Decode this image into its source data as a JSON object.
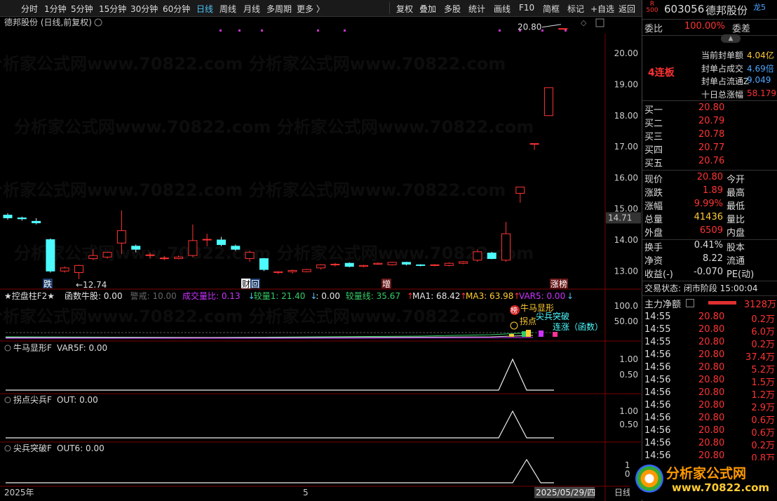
{
  "toolbar": {
    "left": [
      "分时",
      "1分钟",
      "5分钟",
      "15分钟",
      "30分钟",
      "60分钟",
      "日线",
      "周线",
      "月线",
      "多周期",
      "更多 〉"
    ],
    "active": "日线",
    "right": [
      "复权",
      "叠加",
      "多股",
      "统计",
      "画线",
      "F10",
      "简框",
      "标记",
      "+自选",
      "返回"
    ]
  },
  "stock": {
    "code": "603056",
    "name": "德邦股份",
    "market_badge": "R",
    "market_sub": "500",
    "tag": "龙5",
    "chart_title": "德邦股份 (日线,前复权)"
  },
  "main_chart": {
    "yticks": [
      "20.00",
      "19.00",
      "18.00",
      "17.00",
      "16.00",
      "15.00",
      "14.00",
      "13.00"
    ],
    "current_price_label": "14.71",
    "high_label": "20.80",
    "low_label": "←12.74",
    "markers": [
      "跌",
      "财",
      "回",
      "增",
      "涨",
      "榜"
    ]
  },
  "indicator1": {
    "title": "★控盘柱F2★",
    "items": [
      {
        "t": "函数牛股: 0.00",
        "c": "#e6e6e6"
      },
      {
        "t": "警戒: 10.00",
        "c": "#666666"
      },
      {
        "t": "成交量比: 0.13",
        "c": "#cc33ff"
      },
      {
        "t": "↓",
        "c": "#4fc3f7"
      },
      {
        "t": "较量1: 21.40",
        "c": "#33cc66"
      },
      {
        "t": "↓",
        "c": "#4fc3f7"
      },
      {
        "t": ": 0.00",
        "c": "#e6e6e6"
      },
      {
        "t": "较量线: 35.67",
        "c": "#33cc66"
      },
      {
        "t": "↑",
        "c": "#ff3333"
      },
      {
        "t": "MA1: 68.42",
        "c": "#e6e6e6"
      },
      {
        "t": "↑",
        "c": "#ff3333"
      },
      {
        "t": "MA3: 63.98",
        "c": "#ffcc33"
      },
      {
        "t": "↑",
        "c": "#ff3333"
      },
      {
        "t": "VAR5: 0.00",
        "c": "#cc33ff"
      },
      {
        "t": "↓",
        "c": "#4fc3f7"
      }
    ],
    "yticks": [
      "100.0",
      "50.00"
    ],
    "labels": [
      "牛马显形",
      "尖兵突破",
      "拐点",
      "连涨（函数）",
      "榜"
    ]
  },
  "indicator2": {
    "title": "牛马显形F",
    "var": "VAR5F: 0.00",
    "yticks": [
      "1.00",
      "0.50"
    ]
  },
  "indicator3": {
    "title": "拐点尖兵F",
    "var": "OUT: 0.00",
    "yticks": [
      "1.00",
      "0.50"
    ]
  },
  "indicator4": {
    "title": "尖兵突破F",
    "var": "OUT6: 0.00",
    "yticks": [
      "1.0",
      "0.5"
    ]
  },
  "xaxis": {
    "left": "2025年",
    "mid": "5",
    "date": "2025/05/29/四",
    "mode": "日线"
  },
  "quote": {
    "weibi_label": "委比",
    "weibi": "100.00%",
    "weicha_label": "委差",
    "lianban": "4连板",
    "seal": [
      {
        "k": "当前封单额",
        "v": "4.04亿",
        "c": "#ffcc33"
      },
      {
        "k": "封单占成交",
        "v": "4.69倍",
        "c": "#4da6ff"
      },
      {
        "k": "封单占流通Z",
        "v": "9.049",
        "c": "#4da6ff"
      },
      {
        "k": "十日总涨幅",
        "v": "58.179",
        "c": "#ff3333"
      }
    ],
    "bids": [
      {
        "k": "买一",
        "p": "20.80",
        "v": ""
      },
      {
        "k": "买二",
        "p": "20.79",
        "v": ""
      },
      {
        "k": "买三",
        "p": "20.78",
        "v": ""
      },
      {
        "k": "买四",
        "p": "20.77",
        "v": ""
      },
      {
        "k": "买五",
        "p": "20.76",
        "v": ""
      }
    ],
    "stats": [
      {
        "k": "现价",
        "v": "20.80",
        "vc": "#ff3333",
        "k2": "今开"
      },
      {
        "k": "涨跌",
        "v": "1.89",
        "vc": "#ff3333",
        "k2": "最高"
      },
      {
        "k": "涨幅",
        "v": "9.99%",
        "vc": "#ff3333",
        "k2": "最低"
      },
      {
        "k": "总量",
        "v": "41436",
        "vc": "#ffcc33",
        "k2": "量比"
      },
      {
        "k": "外盘",
        "v": "6509",
        "vc": "#ff3333",
        "k2": "内盘"
      }
    ],
    "stats2": [
      {
        "k": "换手",
        "v": "0.41%",
        "k2": "股本"
      },
      {
        "k": "净资",
        "v": "8.22",
        "k2": "流通"
      },
      {
        "k": "收益(-)",
        "v": "-0.070",
        "k2": "PE(动)"
      }
    ],
    "trade_status": "交易状态: 闭市阶段 15:00:04",
    "main_net_label": "主力净额",
    "main_net_value": "3128万",
    "ticks": [
      {
        "t": "14:55",
        "p": "20.80",
        "v": "0.2万"
      },
      {
        "t": "14:55",
        "p": "20.80",
        "v": "6.0万"
      },
      {
        "t": "14:55",
        "p": "20.80",
        "v": "0.2万"
      },
      {
        "t": "14:56",
        "p": "20.80",
        "v": "37.4万"
      },
      {
        "t": "14:56",
        "p": "20.80",
        "v": "5.2万"
      },
      {
        "t": "14:56",
        "p": "20.80",
        "v": "1.5万"
      },
      {
        "t": "14:56",
        "p": "20.80",
        "v": "1.2万"
      },
      {
        "t": "14:56",
        "p": "20.80",
        "v": "2.9万"
      },
      {
        "t": "14:56",
        "p": "20.80",
        "v": "0.6万"
      },
      {
        "t": "14:56",
        "p": "20.80",
        "v": "0.6万"
      },
      {
        "t": "14:56",
        "p": "20.80",
        "v": "0.2万"
      },
      {
        "t": "14:56",
        "p": "20.80",
        "v": "0.8万"
      }
    ]
  },
  "watermark": "分析家公式网www.70822.com",
  "logo": {
    "text": "分析家公式网",
    "url": "www.70822.com"
  },
  "chart_data": {
    "type": "candlestick",
    "candles": [
      [
        14.8,
        14.71,
        14.65,
        14.86
      ],
      [
        14.71,
        14.68,
        14.62,
        14.75
      ],
      [
        14.6,
        14.55,
        14.5,
        14.7
      ],
      [
        14.01,
        13.0,
        12.95,
        14.05
      ],
      [
        13.0,
        13.1,
        12.95,
        13.15
      ],
      [
        12.95,
        13.18,
        12.74,
        13.2
      ],
      [
        13.4,
        13.5,
        13.35,
        13.7
      ],
      [
        13.45,
        13.6,
        13.4,
        13.62
      ],
      [
        13.9,
        14.3,
        13.55,
        14.95
      ],
      [
        13.8,
        13.7,
        13.6,
        13.85
      ],
      [
        13.5,
        13.52,
        13.4,
        13.6
      ],
      [
        13.4,
        13.42,
        13.35,
        13.48
      ],
      [
        13.4,
        13.45,
        13.38,
        13.5
      ],
      [
        13.5,
        13.98,
        13.45,
        14.5
      ],
      [
        14.0,
        14.02,
        13.8,
        14.2
      ],
      [
        14.0,
        13.85,
        13.8,
        14.1
      ],
      [
        13.8,
        13.7,
        13.65,
        13.85
      ],
      [
        13.4,
        13.6,
        13.3,
        13.65
      ],
      [
        13.4,
        13.05,
        13.0,
        13.42
      ],
      [
        12.95,
        12.98,
        12.9,
        13.0
      ],
      [
        12.98,
        13.02,
        12.92,
        13.05
      ],
      [
        12.98,
        13.05,
        12.96,
        13.07
      ],
      [
        13.1,
        13.2,
        13.05,
        13.22
      ],
      [
        13.2,
        13.22,
        13.15,
        13.26
      ],
      [
        13.25,
        13.15,
        13.12,
        13.28
      ],
      [
        13.15,
        13.18,
        13.12,
        13.2
      ],
      [
        13.22,
        13.25,
        13.2,
        13.28
      ],
      [
        13.2,
        13.28,
        13.18,
        13.3
      ],
      [
        13.28,
        13.22,
        13.18,
        13.3
      ],
      [
        13.2,
        13.18,
        13.15,
        13.22
      ],
      [
        13.18,
        13.2,
        13.15,
        13.22
      ],
      [
        13.18,
        13.25,
        13.15,
        13.28
      ],
      [
        13.25,
        13.3,
        13.22,
        13.32
      ],
      [
        13.35,
        13.62,
        13.3,
        13.7
      ],
      [
        13.58,
        13.4,
        13.38,
        13.62
      ],
      [
        13.35,
        14.2,
        13.3,
        14.58
      ],
      [
        15.5,
        15.7,
        15.2,
        15.7
      ],
      [
        17.1,
        17.1,
        16.9,
        17.1
      ],
      [
        18.0,
        18.9,
        18.0,
        18.9
      ],
      [
        20.8,
        20.8,
        20.8,
        20.8
      ]
    ],
    "ymin": 12.6,
    "ymax": 21.0
  }
}
